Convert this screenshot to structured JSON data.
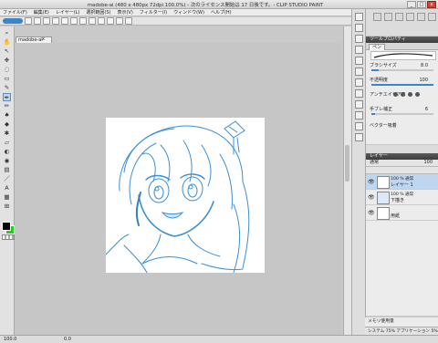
{
  "window": {
    "title": "madobe-ai (480 x 480px 72dpi 100.0%) - 次のライセンス開始は 17 日後です。- CLIP STUDIO PAINT",
    "buttons": [
      "_",
      "□",
      "x"
    ]
  },
  "menu": [
    "ファイル(F)",
    "編集(E)",
    "レイヤー(L)",
    "選択範囲(S)",
    "表示(V)",
    "フィルター(I)",
    "ウィンドウ(W)",
    "ヘルプ(H)"
  ],
  "document": {
    "tab_label": "madobe-ai",
    "close_glyph": "x"
  },
  "tool_property": {
    "header": "ツールプロパティ",
    "tab": "ペン",
    "brush_size_label": "ブラシサイズ",
    "brush_size_value": "8.0",
    "brush_size_fraction": 0.12,
    "opacity_label": "不透明度",
    "opacity_value": "100",
    "opacity_fraction": 1.0,
    "antialias_label": "アンチエイリアス",
    "stabilization_label": "手ブレ補正",
    "stabilization_value": "6",
    "stabilization_fraction": 0.06,
    "vector_label": "ベクター吸着"
  },
  "layer_panel": {
    "header": "レイヤー",
    "blend_mode": "通常",
    "opacity": "100",
    "layers": [
      {
        "opacity_mode": "100 % 通常",
        "name": "レイヤー 1",
        "selected": true
      },
      {
        "opacity_mode": "100 % 通常",
        "name": "下描き",
        "selected": false
      },
      {
        "opacity_mode": "",
        "name": "用紙",
        "selected": false
      }
    ]
  },
  "memory_label": "メモリ使用量",
  "status_text": "システム 75% アプリケーション 5%",
  "footer": {
    "zoom": "100.0",
    "angle": "0.0"
  },
  "colors": {
    "main_color": "#000000",
    "sub_color": "#1fd11f",
    "sketch_line": "#3a8fd6",
    "accent": "#3a86c8"
  },
  "tools": [
    "zoom-icon",
    "hand-icon",
    "operation-icon",
    "move-icon",
    "lasso-icon",
    "select-icon",
    "eyedropper-icon",
    "pen-icon",
    "pencil-icon",
    "brush-icon",
    "airbrush-icon",
    "decoration-icon",
    "eraser-icon",
    "blend-icon",
    "fill-icon",
    "gradient-icon",
    "figure-icon",
    "text-icon",
    "frame-icon",
    "ruler-icon"
  ]
}
